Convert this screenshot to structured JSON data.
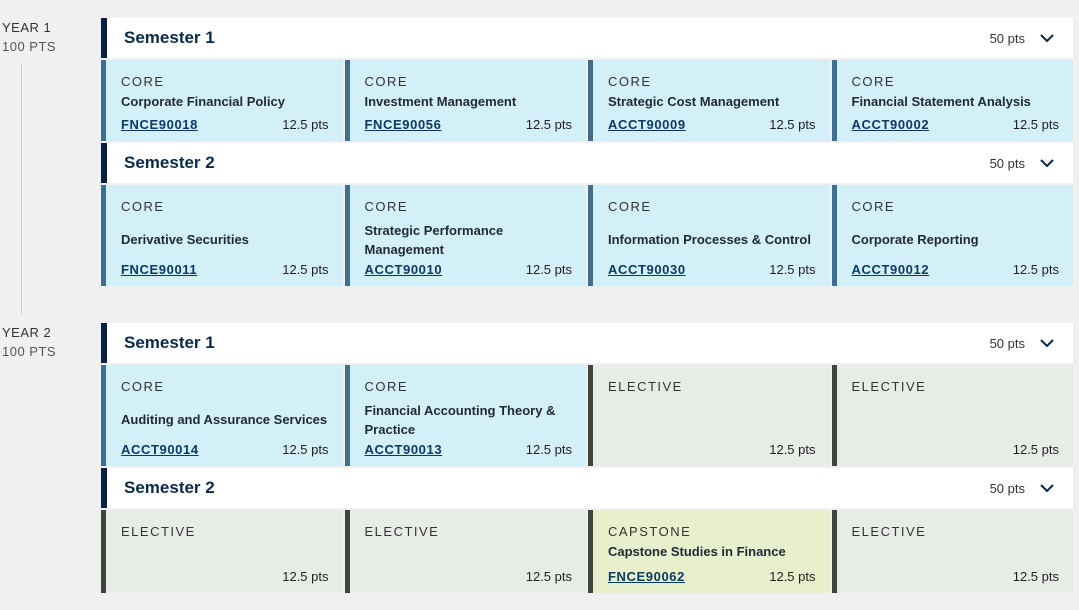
{
  "years": [
    {
      "label": "YEAR 1",
      "points": "100 PTS",
      "semesters": [
        {
          "title": "Semester 1",
          "points": "50 pts",
          "subjects": [
            {
              "type": "CORE",
              "name": "Corporate Financial Policy",
              "code": "FNCE90018",
              "points": "12.5 pts"
            },
            {
              "type": "CORE",
              "name": "Investment Management",
              "code": "FNCE90056",
              "points": "12.5 pts"
            },
            {
              "type": "CORE",
              "name": "Strategic Cost Management",
              "code": "ACCT90009",
              "points": "12.5 pts"
            },
            {
              "type": "CORE",
              "name": "Financial Statement Analysis",
              "code": "ACCT90002",
              "points": "12.5 pts"
            }
          ]
        },
        {
          "title": "Semester 2",
          "points": "50 pts",
          "subjects": [
            {
              "type": "CORE",
              "name": "Derivative Securities",
              "code": "FNCE90011",
              "points": "12.5 pts"
            },
            {
              "type": "CORE",
              "name": "Strategic Performance Management",
              "code": "ACCT90010",
              "points": "12.5 pts"
            },
            {
              "type": "CORE",
              "name": "Information Processes & Control",
              "code": "ACCT90030",
              "points": "12.5 pts"
            },
            {
              "type": "CORE",
              "name": "Corporate Reporting",
              "code": "ACCT90012",
              "points": "12.5 pts"
            }
          ]
        }
      ]
    },
    {
      "label": "YEAR 2",
      "points": "100 PTS",
      "semesters": [
        {
          "title": "Semester 1",
          "points": "50 pts",
          "subjects": [
            {
              "type": "CORE",
              "name": "Auditing and Assurance Services",
              "code": "ACCT90014",
              "points": "12.5 pts"
            },
            {
              "type": "CORE",
              "name": "Financial Accounting Theory & Practice",
              "code": "ACCT90013",
              "points": "12.5 pts"
            },
            {
              "type": "ELECTIVE",
              "name": "",
              "code": "",
              "points": "12.5 pts"
            },
            {
              "type": "ELECTIVE",
              "name": "",
              "code": "",
              "points": "12.5 pts"
            }
          ]
        },
        {
          "title": "Semester 2",
          "points": "50 pts",
          "subjects": [
            {
              "type": "ELECTIVE",
              "name": "",
              "code": "",
              "points": "12.5 pts"
            },
            {
              "type": "ELECTIVE",
              "name": "",
              "code": "",
              "points": "12.5 pts"
            },
            {
              "type": "CAPSTONE",
              "name": "Capstone Studies in Finance",
              "code": "FNCE90062",
              "points": "12.5 pts"
            },
            {
              "type": "ELECTIVE",
              "name": "",
              "code": "",
              "points": "12.5 pts"
            }
          ]
        }
      ]
    }
  ]
}
